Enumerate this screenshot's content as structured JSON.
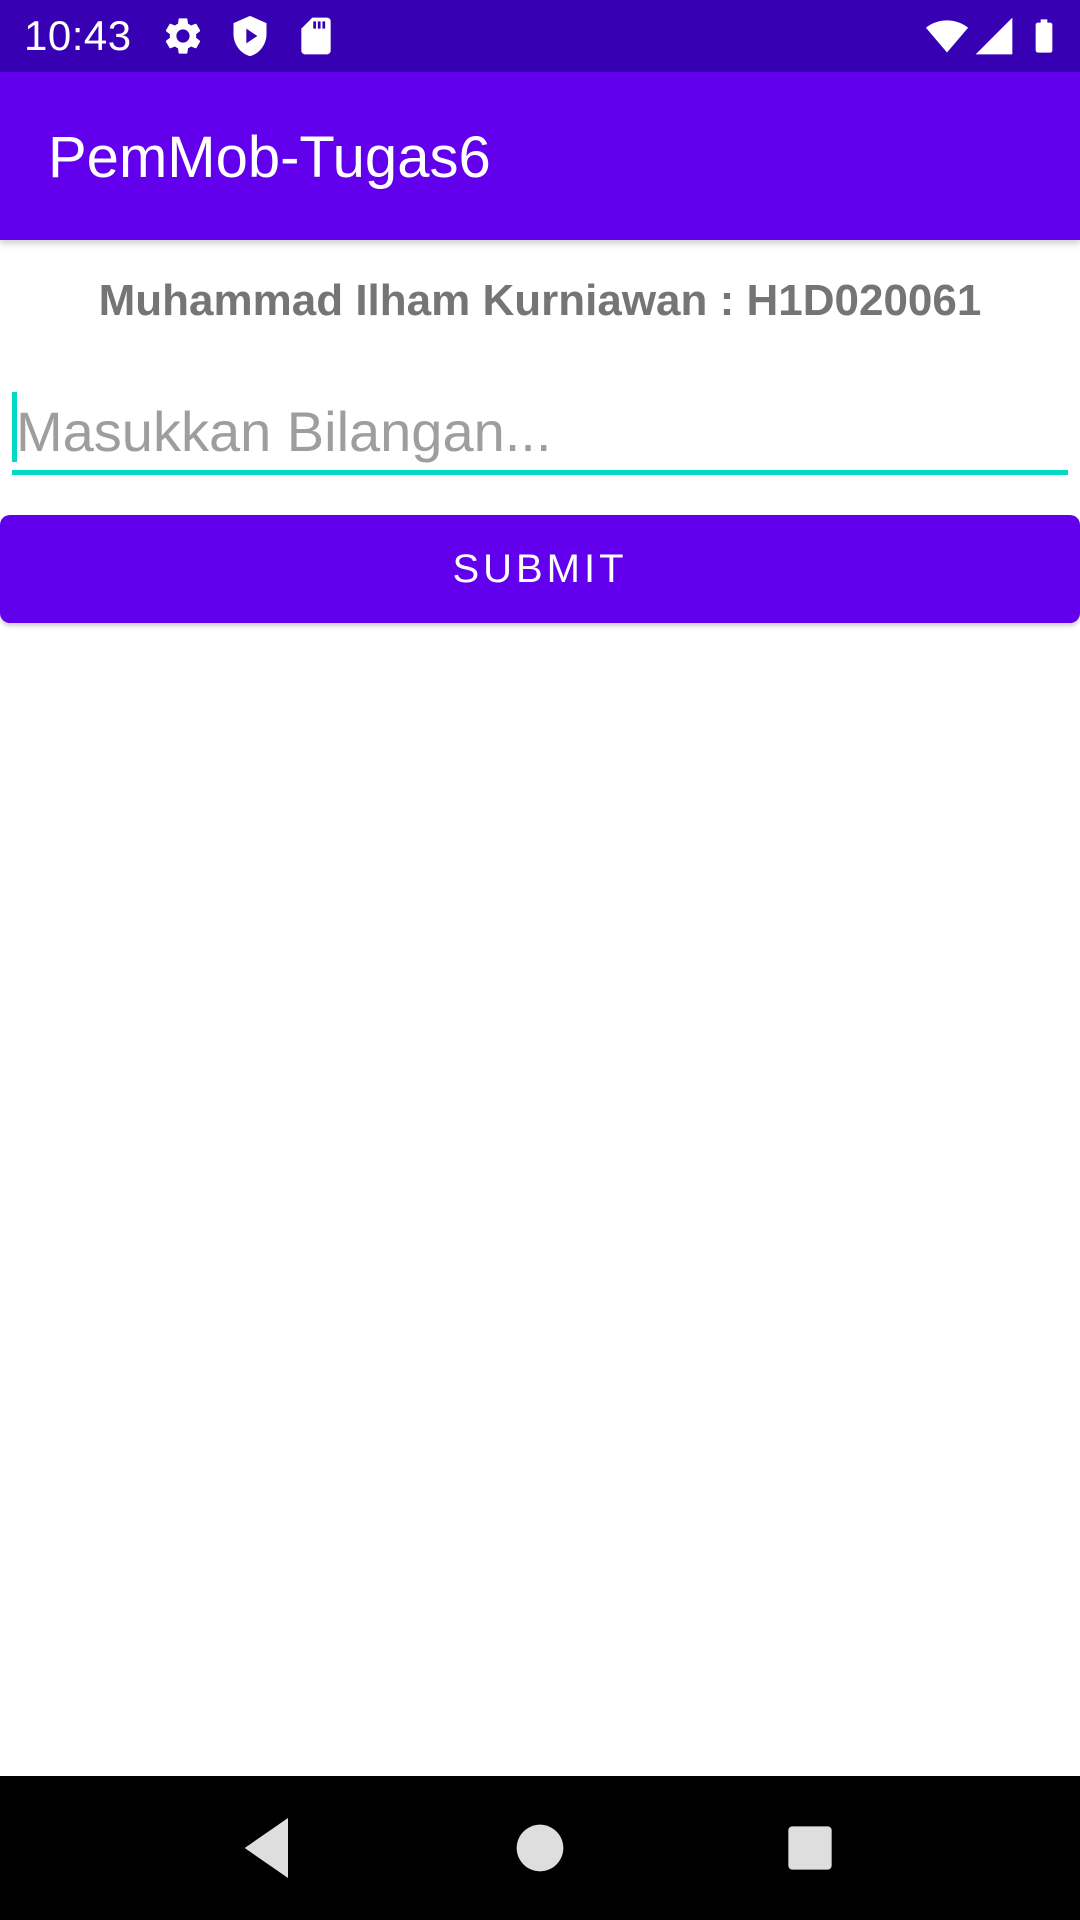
{
  "status_bar": {
    "time": "10:43",
    "icons_left": [
      "gear-icon",
      "shield-play-icon",
      "sd-card-icon"
    ],
    "icons_right": [
      "wifi-icon",
      "cell-signal-icon",
      "battery-icon"
    ]
  },
  "app_bar": {
    "title": "PemMob-Tugas6"
  },
  "main": {
    "name_label": "Muhammad Ilham Kurniawan : H1D020061",
    "number_input": {
      "value": "",
      "placeholder": "Masukkan Bilangan..."
    },
    "submit_label": "SUBMIT"
  },
  "nav_bar": {
    "buttons": [
      "back-icon",
      "home-icon",
      "recents-icon"
    ]
  },
  "colors": {
    "status_bar": "#3700b3",
    "primary": "#6200ee",
    "accent": "#03dac5",
    "label_text": "#757575",
    "nav_bar": "#000000"
  }
}
